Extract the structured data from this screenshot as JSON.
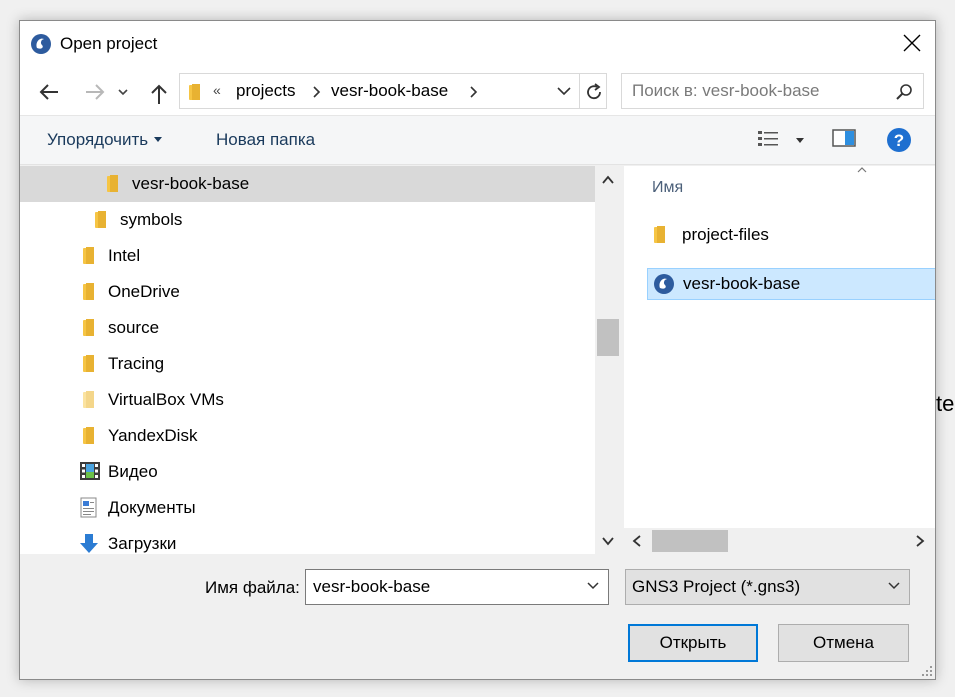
{
  "window": {
    "title": "Open project"
  },
  "background_fragment": "te",
  "nav": {
    "address_crumbs": [
      "projects",
      "vesr-book-base"
    ],
    "more_glyph": "«"
  },
  "search": {
    "placeholder": "Поиск в: vesr-book-base"
  },
  "toolbar": {
    "organize_label": "Упорядочить",
    "new_folder_label": "Новая папка"
  },
  "tree": {
    "items": [
      {
        "label": "vesr-book-base",
        "icon": "folder-icon",
        "selected": true
      },
      {
        "label": "symbols",
        "icon": "folder-icon"
      },
      {
        "label": "Intel",
        "icon": "folder-icon"
      },
      {
        "label": "OneDrive",
        "icon": "folder-icon"
      },
      {
        "label": "source",
        "icon": "folder-icon"
      },
      {
        "label": "Tracing",
        "icon": "folder-icon"
      },
      {
        "label": "VirtualBox VMs",
        "icon": "folder-light-icon"
      },
      {
        "label": "YandexDisk",
        "icon": "folder-icon"
      },
      {
        "label": "Видео",
        "icon": "video-folder-icon"
      },
      {
        "label": "Документы",
        "icon": "documents-folder-icon"
      },
      {
        "label": "Загрузки",
        "icon": "downloads-folder-icon"
      }
    ]
  },
  "files": {
    "column_header": "Имя",
    "items": [
      {
        "label": "project-files",
        "icon": "folder-icon"
      },
      {
        "label": "vesr-book-base",
        "icon": "gns3-project-icon",
        "selected": true
      }
    ]
  },
  "bottom": {
    "filename_label": "Имя файла:",
    "filename_value": "vesr-book-base",
    "filetype_value": "GNS3 Project (*.gns3)",
    "open_label": "Открыть",
    "cancel_label": "Отмена"
  },
  "colors": {
    "selection_fill": "#cce8ff",
    "tree_selection": "#d9d9d9",
    "accent": "#0078d7",
    "folder": "#f6c544"
  }
}
